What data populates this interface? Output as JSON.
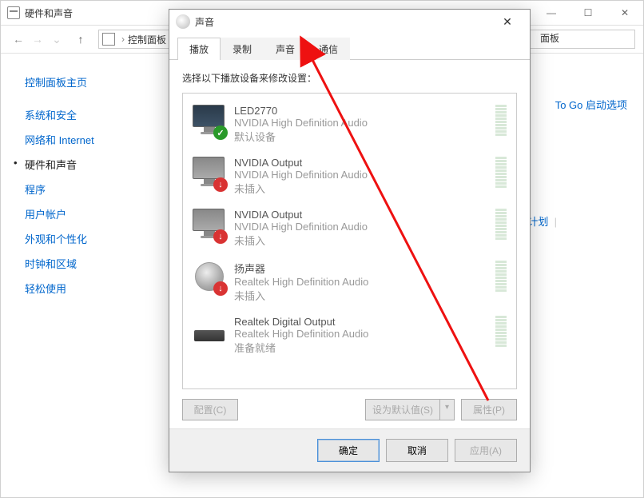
{
  "bg_window": {
    "title": "硬件和声音",
    "breadcrumb": [
      "控制面板",
      "面板"
    ],
    "extra_link1": "To Go 启动选项",
    "extra_link2": "计划"
  },
  "sidebar": {
    "header": "控制面板主页",
    "items": [
      {
        "label": "系统和安全"
      },
      {
        "label": "网络和 Internet"
      },
      {
        "label": "硬件和声音",
        "active": true
      },
      {
        "label": "程序"
      },
      {
        "label": "用户帐户"
      },
      {
        "label": "外观和个性化"
      },
      {
        "label": "时钟和区域"
      },
      {
        "label": "轻松使用"
      }
    ]
  },
  "dialog": {
    "title": "声音",
    "close": "✕",
    "tabs": [
      {
        "label": "播放",
        "active": true
      },
      {
        "label": "录制"
      },
      {
        "label": "声音"
      },
      {
        "label": "通信"
      }
    ],
    "instruction": "选择以下播放设备来修改设置：",
    "devices": [
      {
        "name": "LED2770",
        "desc": "NVIDIA High Definition Audio",
        "status": "默认设备",
        "icon": "monitor",
        "overlay": "check"
      },
      {
        "name": "NVIDIA Output",
        "desc": "NVIDIA High Definition Audio",
        "status": "未插入",
        "icon": "monitor",
        "overlay": "down"
      },
      {
        "name": "NVIDIA Output",
        "desc": "NVIDIA High Definition Audio",
        "status": "未插入",
        "icon": "monitor",
        "overlay": "down"
      },
      {
        "name": "扬声器",
        "desc": "Realtek High Definition Audio",
        "status": "未插入",
        "icon": "speaker",
        "overlay": "down"
      },
      {
        "name": "Realtek Digital Output",
        "desc": "Realtek High Definition Audio",
        "status": "准备就绪",
        "icon": "digital",
        "overlay": ""
      }
    ],
    "buttons": {
      "configure": "配置(C)",
      "set_default": "设为默认值(S)",
      "properties": "属性(P)"
    },
    "footer": {
      "ok": "确定",
      "cancel": "取消",
      "apply": "应用(A)"
    }
  }
}
